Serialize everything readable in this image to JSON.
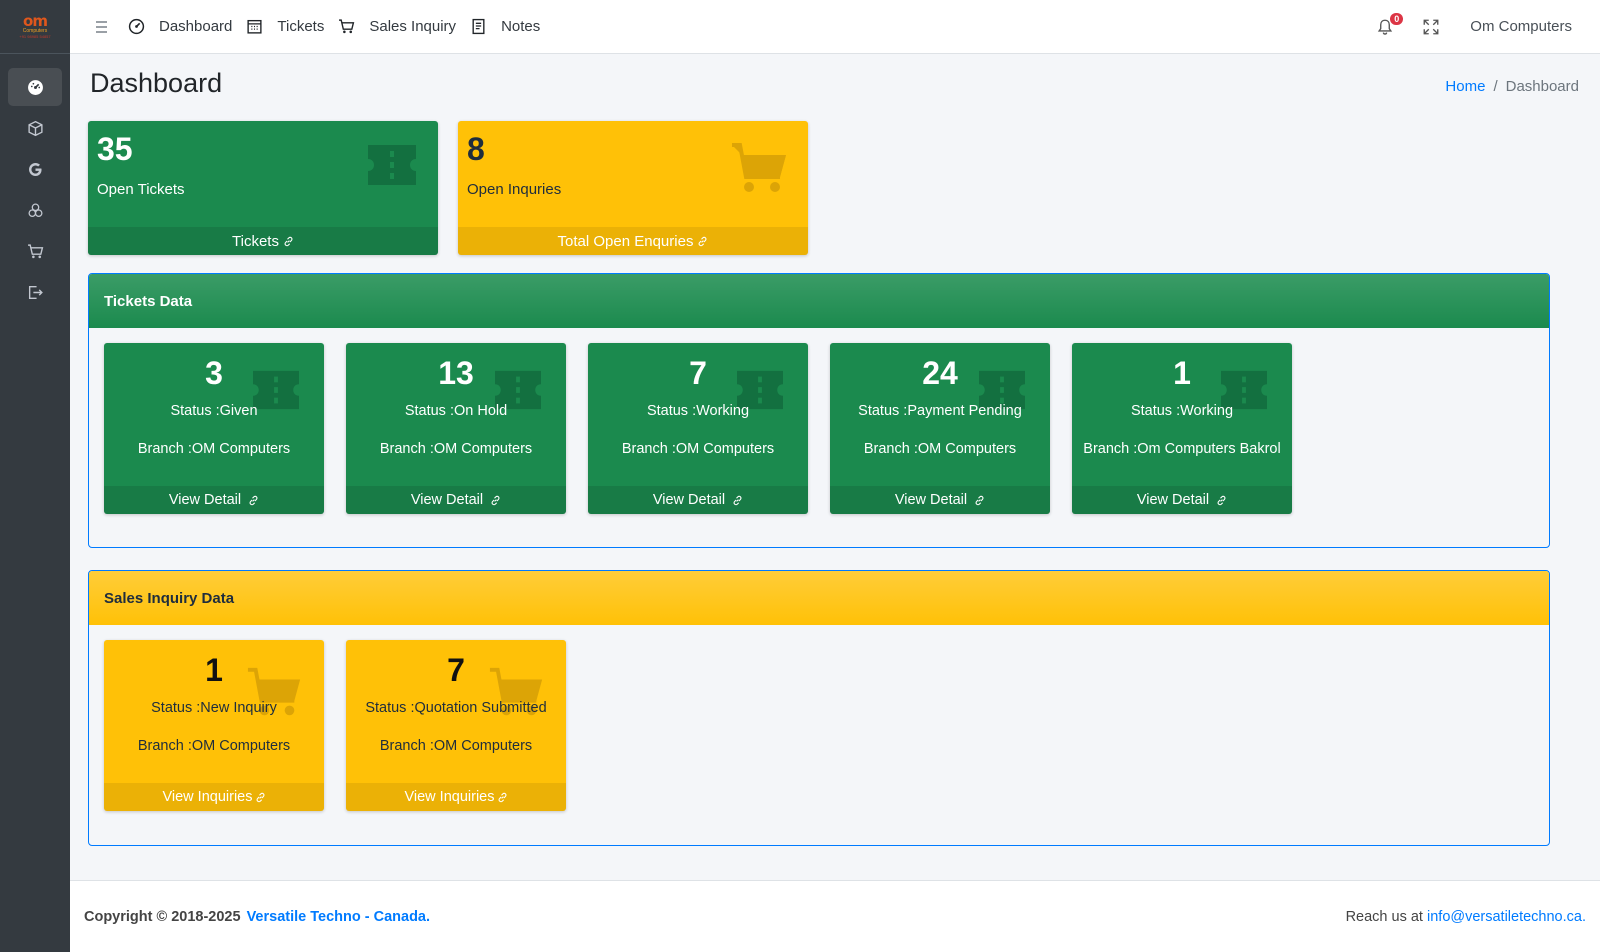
{
  "logo": {
    "main": "om",
    "sub": "Computers",
    "phone": "+91 98985 54857"
  },
  "sidebar": {
    "items": [
      {
        "icon": "dashboard-gauge-icon",
        "active": true
      },
      {
        "icon": "box-icon",
        "active": false
      },
      {
        "icon": "google-icon",
        "active": false
      },
      {
        "icon": "cubes-icon",
        "active": false
      },
      {
        "icon": "cart-icon",
        "active": false
      },
      {
        "icon": "logout-icon",
        "active": false
      }
    ]
  },
  "topnav": {
    "links": [
      {
        "label": "Dashboard",
        "icon": "gauge-icon"
      },
      {
        "label": "Tickets",
        "icon": "calendar-icon"
      },
      {
        "label": "Sales Inquiry",
        "icon": "cart-icon"
      },
      {
        "label": "Notes",
        "icon": "note-icon"
      }
    ],
    "notification_count": "0",
    "user": "Om Computers"
  },
  "page": {
    "title": "Dashboard",
    "breadcrumb": {
      "home": "Home",
      "separator": "/",
      "current": "Dashboard"
    }
  },
  "summary": {
    "tickets": {
      "value": "35",
      "label": "Open Tickets",
      "footer": "Tickets",
      "color": "#1b8a4e"
    },
    "inquiries": {
      "value": "8",
      "label": "Open Inquries",
      "footer": "Total Open Enquries",
      "color": "#ffc107"
    }
  },
  "tickets_data": {
    "title": "Tickets Data",
    "footer_label": "View Detail",
    "items": [
      {
        "value": "3",
        "status": "Status :Given",
        "branch": "Branch :OM Computers"
      },
      {
        "value": "13",
        "status": "Status :On Hold",
        "branch": "Branch :OM Computers"
      },
      {
        "value": "7",
        "status": "Status :Working",
        "branch": "Branch :OM Computers"
      },
      {
        "value": "24",
        "status": "Status :Payment Pending",
        "branch": "Branch :OM Computers"
      },
      {
        "value": "1",
        "status": "Status :Working",
        "branch": "Branch :Om Computers Bakrol"
      }
    ]
  },
  "sales_data": {
    "title": "Sales Inquiry Data",
    "footer_label": "View Inquiries",
    "items": [
      {
        "value": "1",
        "status": "Status :New Inquiry",
        "branch": "Branch :OM Computers"
      },
      {
        "value": "7",
        "status": "Status :Quotation Submitted",
        "branch": "Branch :OM Computers"
      }
    ]
  },
  "footer": {
    "copyright": "Copyright © 2018-2025",
    "brand": "Versatile Techno - Canada.",
    "reach": "Reach us at",
    "email": "info@versatiletechno.ca."
  }
}
